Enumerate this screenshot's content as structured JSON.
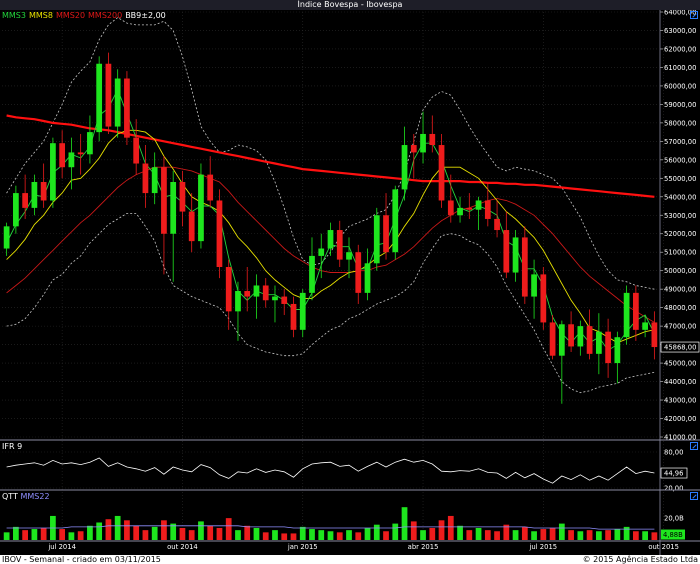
{
  "title": "Índice Bovespa - Ibovespa",
  "legend": [
    {
      "label": "MMS3",
      "color": "#23d43c"
    },
    {
      "label": "MMS8",
      "color": "#e6e000"
    },
    {
      "label": "MMS20",
      "color": "#e01818"
    },
    {
      "label": "MMS200",
      "color": "#e01818"
    },
    {
      "label": "BB9±2,00",
      "color": "#ffffff"
    }
  ],
  "ifr_label": "IFR 9",
  "volume_labels": [
    {
      "label": "QTT",
      "color": "#ffffff"
    },
    {
      "label": "MMS22",
      "color": "#8f8fff"
    }
  ],
  "footer": {
    "left": "IBOV - Semanal - criado em 03/11/2015",
    "right": "© 2015 Agência Estado Ltda"
  },
  "colors": {
    "up": "#1ee61e",
    "down": "#ee1c1c",
    "mms3": "#23d43c",
    "mms8": "#e6e000",
    "mms20": "#c81818",
    "mms200": "#ff1010",
    "bb": "#c8c8c8",
    "ifr": "#ffffff",
    "vol_ma": "#8f8fff",
    "grid": "#2a2a2a",
    "separator": "#8a8aa0"
  },
  "chart_data": [
    {
      "type": "candlestick",
      "name": "price",
      "ylim": [
        41000,
        64000
      ],
      "y_ticks": [
        "41000,00",
        "42000,00",
        "43000,00",
        "44000,00",
        "45000,00",
        "46000,00",
        "47000,00",
        "48000,00",
        "49000,00",
        "50000,00",
        "51000,00",
        "52000,00",
        "53000,00",
        "54000,00",
        "55000,00",
        "56000,00",
        "57000,00",
        "58000,00",
        "59000,00",
        "60000,00",
        "61000,00",
        "62000,00",
        "63000,00",
        "64000,00"
      ],
      "x_ticks": [
        {
          "label": "jul 2014",
          "index": 6
        },
        {
          "label": "out 2014",
          "index": 19
        },
        {
          "label": "jan 2015",
          "index": 32
        },
        {
          "label": "abr 2015",
          "index": 45
        },
        {
          "label": "jul 2015",
          "index": 58
        },
        {
          "label": "out 2015",
          "index": 71
        }
      ],
      "last_value": 45868,
      "last_value_label": "45868,00",
      "candles": [
        [
          51200,
          52600,
          50800,
          52400
        ],
        [
          52400,
          54600,
          52000,
          54200
        ],
        [
          54200,
          55200,
          52800,
          53400
        ],
        [
          53400,
          55200,
          53000,
          54800
        ],
        [
          54800,
          55800,
          53400,
          53800
        ],
        [
          53800,
          57200,
          53400,
          56900
        ],
        [
          56900,
          57600,
          55000,
          55600
        ],
        [
          55600,
          57200,
          54400,
          56400
        ],
        [
          56400,
          57400,
          55200,
          56300
        ],
        [
          56300,
          58400,
          55800,
          57500
        ],
        [
          57500,
          61600,
          57000,
          61200
        ],
        [
          61200,
          61800,
          57400,
          57800
        ],
        [
          57800,
          60900,
          57200,
          60400
        ],
        [
          60400,
          60800,
          56800,
          57200
        ],
        [
          57200,
          58200,
          55200,
          55800
        ],
        [
          55800,
          56800,
          53400,
          54200
        ],
        [
          54200,
          56400,
          53600,
          55600
        ],
        [
          55600,
          56200,
          49800,
          52000
        ],
        [
          52000,
          55400,
          49400,
          54800
        ],
        [
          54800,
          55400,
          52400,
          53200
        ],
        [
          53200,
          54200,
          51000,
          51600
        ],
        [
          51600,
          55800,
          51200,
          55200
        ],
        [
          55200,
          56200,
          53400,
          53800
        ],
        [
          53800,
          54400,
          49600,
          50200
        ],
        [
          50200,
          50600,
          46800,
          47800
        ],
        [
          47800,
          49400,
          46200,
          48900
        ],
        [
          48900,
          50200,
          47800,
          48600
        ],
        [
          48600,
          49800,
          47400,
          49200
        ],
        [
          49200,
          49600,
          48000,
          48400
        ],
        [
          48400,
          49200,
          47200,
          48600
        ],
        [
          48600,
          49000,
          47600,
          48200
        ],
        [
          48200,
          48600,
          46400,
          46800
        ],
        [
          46800,
          49000,
          46400,
          48800
        ],
        [
          48800,
          51800,
          48400,
          50800
        ],
        [
          50800,
          52000,
          49600,
          51200
        ],
        [
          51200,
          52600,
          50800,
          52200
        ],
        [
          52200,
          52700,
          50200,
          50600
        ],
        [
          50600,
          51800,
          49600,
          51000
        ],
        [
          51000,
          51400,
          48200,
          48800
        ],
        [
          48800,
          51200,
          48400,
          50400
        ],
        [
          50400,
          53400,
          50000,
          53000
        ],
        [
          53000,
          54200,
          50600,
          51000
        ],
        [
          51000,
          54600,
          50600,
          54400
        ],
        [
          54400,
          57800,
          53800,
          56800
        ],
        [
          56800,
          57400,
          55000,
          56400
        ],
        [
          56400,
          58600,
          55800,
          57400
        ],
        [
          57400,
          58400,
          56400,
          56800
        ],
        [
          56800,
          57400,
          53400,
          53800
        ],
        [
          53800,
          55200,
          52600,
          53000
        ],
        [
          53000,
          54000,
          52600,
          53400
        ],
        [
          53400,
          54200,
          52800,
          53300
        ],
        [
          53300,
          54000,
          52200,
          53800
        ],
        [
          53800,
          54800,
          52400,
          52800
        ],
        [
          52800,
          53800,
          51800,
          52200
        ],
        [
          52200,
          53200,
          49600,
          49900
        ],
        [
          49900,
          52200,
          49400,
          51800
        ],
        [
          51800,
          52400,
          48200,
          48600
        ],
        [
          48600,
          50600,
          47400,
          49800
        ],
        [
          49800,
          50200,
          46800,
          47200
        ],
        [
          47200,
          47600,
          45200,
          45400
        ],
        [
          45400,
          47300,
          42800,
          47100
        ],
        [
          47100,
          47800,
          45600,
          45900
        ],
        [
          45900,
          47300,
          45400,
          47000
        ],
        [
          47000,
          47900,
          45200,
          45500
        ],
        [
          45500,
          47700,
          44400,
          46700
        ],
        [
          46700,
          47400,
          44200,
          45000
        ],
        [
          45000,
          46700,
          43900,
          46400
        ],
        [
          46400,
          49200,
          46000,
          48800
        ],
        [
          48800,
          49200,
          46200,
          46800
        ],
        [
          46800,
          47600,
          46400,
          47200
        ],
        [
          47200,
          47800,
          45200,
          45868
        ]
      ],
      "series": [
        {
          "key": "mms3",
          "values": [
            51500,
            52500,
            53200,
            54100,
            54000,
            55300,
            55700,
            56300,
            56100,
            56700,
            58400,
            58800,
            59800,
            58500,
            57200,
            55800,
            55200,
            54000,
            54100,
            53700,
            53200,
            53500,
            53500,
            53000,
            50700,
            48900,
            48400,
            48900,
            48700,
            48700,
            48400,
            47900,
            47900,
            48800,
            50300,
            51400,
            51300,
            51300,
            50100,
            50100,
            51400,
            51500,
            52800,
            54100,
            56000,
            56900,
            56900,
            56000,
            54600,
            53400,
            53200,
            53500,
            53300,
            53000,
            51600,
            51300,
            50100,
            50100,
            49200,
            47500,
            46600,
            46100,
            46700,
            46100,
            46400,
            45700,
            46000,
            46700,
            47300,
            47600,
            46600
          ]
        },
        {
          "key": "mms8",
          "values": [
            50600,
            51100,
            51700,
            52500,
            53000,
            53700,
            54200,
            54900,
            55000,
            55500,
            56100,
            56900,
            57400,
            57600,
            57600,
            57500,
            57100,
            56200,
            55500,
            54700,
            54000,
            53700,
            53500,
            53200,
            52600,
            51800,
            51300,
            50700,
            50000,
            49500,
            49100,
            48700,
            48500,
            48500,
            48900,
            49200,
            49600,
            49900,
            50000,
            50300,
            50700,
            51000,
            51600,
            52400,
            53100,
            54100,
            55000,
            55600,
            55600,
            55600,
            55300,
            55000,
            54400,
            53800,
            53200,
            52800,
            52300,
            51800,
            51100,
            50200,
            49300,
            48400,
            47700,
            46900,
            46700,
            46400,
            46100,
            46300,
            46500,
            46700,
            46800
          ]
        },
        {
          "key": "mms20",
          "values": [
            48800,
            49200,
            49600,
            50100,
            50600,
            51100,
            51600,
            52100,
            52600,
            53000,
            53500,
            54000,
            54500,
            54900,
            55200,
            55400,
            55600,
            55600,
            55600,
            55500,
            55400,
            55200,
            55000,
            54800,
            54300,
            53700,
            53200,
            52700,
            52200,
            51700,
            51200,
            50800,
            50500,
            50200,
            50000,
            49900,
            49900,
            49900,
            50000,
            50000,
            50200,
            50300,
            50600,
            50900,
            51300,
            51800,
            52300,
            52700,
            53000,
            53300,
            53400,
            53600,
            53800,
            53900,
            53800,
            53600,
            53300,
            53000,
            52500,
            52000,
            51400,
            50800,
            50200,
            49700,
            49300,
            48900,
            48500,
            48100,
            47800,
            47500,
            47200
          ]
        },
        {
          "key": "mms200",
          "values": [
            58400,
            58300,
            58250,
            58200,
            58100,
            58000,
            57950,
            57900,
            57800,
            57700,
            57650,
            57600,
            57500,
            57400,
            57300,
            57200,
            57100,
            57000,
            56900,
            56800,
            56700,
            56600,
            56500,
            56400,
            56300,
            56200,
            56100,
            56000,
            55900,
            55800,
            55700,
            55600,
            55500,
            55450,
            55400,
            55350,
            55300,
            55250,
            55200,
            55150,
            55100,
            55050,
            55000,
            54950,
            54900,
            54850,
            54850,
            54850,
            54850,
            54850,
            54800,
            54800,
            54750,
            54750,
            54700,
            54700,
            54650,
            54650,
            54600,
            54550,
            54500,
            54450,
            54400,
            54350,
            54300,
            54250,
            54200,
            54150,
            54100,
            54050,
            54000
          ]
        },
        {
          "key": "bb_upper",
          "values": [
            54200,
            55000,
            55800,
            56400,
            57000,
            58000,
            59000,
            60200,
            60800,
            61300,
            62500,
            63300,
            63700,
            63400,
            63300,
            63300,
            63300,
            63500,
            63000,
            61600,
            59800,
            57800,
            57000,
            56400,
            56500,
            56800,
            56700,
            56500,
            56000,
            54800,
            53400,
            51800,
            50600,
            50300,
            50400,
            51000,
            51800,
            52400,
            52600,
            52800,
            53100,
            53300,
            54100,
            55300,
            57000,
            58700,
            59400,
            59700,
            59500,
            58700,
            57800,
            57000,
            56300,
            55600,
            55400,
            55600,
            55500,
            55400,
            55200,
            55000,
            54500,
            53700,
            52900,
            51800,
            50800,
            50000,
            49500,
            49400,
            49200,
            49100,
            49000
          ]
        },
        {
          "key": "bb_lower",
          "values": [
            47000,
            47100,
            47400,
            48000,
            48700,
            49500,
            49800,
            50400,
            50800,
            51500,
            52000,
            52500,
            52800,
            53100,
            53100,
            52400,
            51600,
            50200,
            49200,
            48900,
            48600,
            48400,
            48200,
            48000,
            47400,
            46600,
            46000,
            45800,
            45600,
            45500,
            45400,
            45400,
            45500,
            46000,
            46400,
            46800,
            47000,
            47400,
            47600,
            47900,
            48200,
            48400,
            48600,
            48900,
            49400,
            50400,
            51200,
            51900,
            52000,
            51900,
            51600,
            51400,
            50900,
            50200,
            49200,
            48400,
            47600,
            46800,
            45800,
            44900,
            44000,
            43600,
            43400,
            43500,
            43700,
            43800,
            43900,
            44200,
            44300,
            44400,
            44500
          ]
        }
      ]
    },
    {
      "type": "line",
      "name": "ifr9",
      "ylim": [
        20,
        80
      ],
      "y_ticks": [
        "20,00",
        "80,00"
      ],
      "last_value_label": "44,96",
      "values": [
        55,
        58,
        60,
        62,
        58,
        66,
        60,
        62,
        59,
        63,
        70,
        56,
        62,
        55,
        52,
        48,
        54,
        43,
        55,
        50,
        47,
        59,
        54,
        42,
        36,
        47,
        45,
        52,
        46,
        50,
        47,
        38,
        52,
        60,
        62,
        63,
        56,
        58,
        48,
        56,
        63,
        55,
        63,
        68,
        63,
        66,
        60,
        48,
        47,
        49,
        48,
        52,
        46,
        45,
        36,
        46,
        37,
        44,
        35,
        28,
        40,
        34,
        42,
        33,
        40,
        33,
        44,
        55,
        44,
        48,
        44.96
      ]
    },
    {
      "type": "bar",
      "name": "volume",
      "y_ticks": [
        "4,88B",
        "20,0B"
      ],
      "values": [
        7,
        12,
        9,
        10,
        11,
        22,
        10,
        7,
        8,
        13,
        16,
        19,
        22,
        18,
        13,
        9,
        12,
        18,
        15,
        11,
        9,
        17,
        13,
        11,
        20,
        9,
        13,
        11,
        7,
        9,
        6,
        6,
        12,
        10,
        9,
        8,
        7,
        9,
        7,
        11,
        14,
        8,
        15,
        30,
        17,
        9,
        11,
        18,
        22,
        13,
        9,
        11,
        9,
        8,
        14,
        9,
        12,
        8,
        10,
        11,
        15,
        9,
        8,
        9,
        8,
        9,
        10,
        12,
        8,
        8,
        7
      ],
      "ma": [
        11,
        11,
        11,
        11,
        11,
        11,
        11,
        12,
        12,
        12,
        12,
        13,
        13,
        13,
        13,
        13,
        13,
        13,
        13,
        13,
        13,
        13,
        13,
        13,
        13,
        13,
        12,
        12,
        12,
        12,
        12,
        11,
        11,
        11,
        11,
        11,
        11,
        11,
        11,
        11,
        11,
        11,
        11,
        12,
        12,
        12,
        12,
        12,
        12,
        12,
        12,
        12,
        12,
        12,
        12,
        12,
        12,
        11,
        11,
        11,
        11,
        11,
        11,
        11,
        10,
        10,
        10,
        10,
        10,
        10,
        10
      ]
    }
  ]
}
